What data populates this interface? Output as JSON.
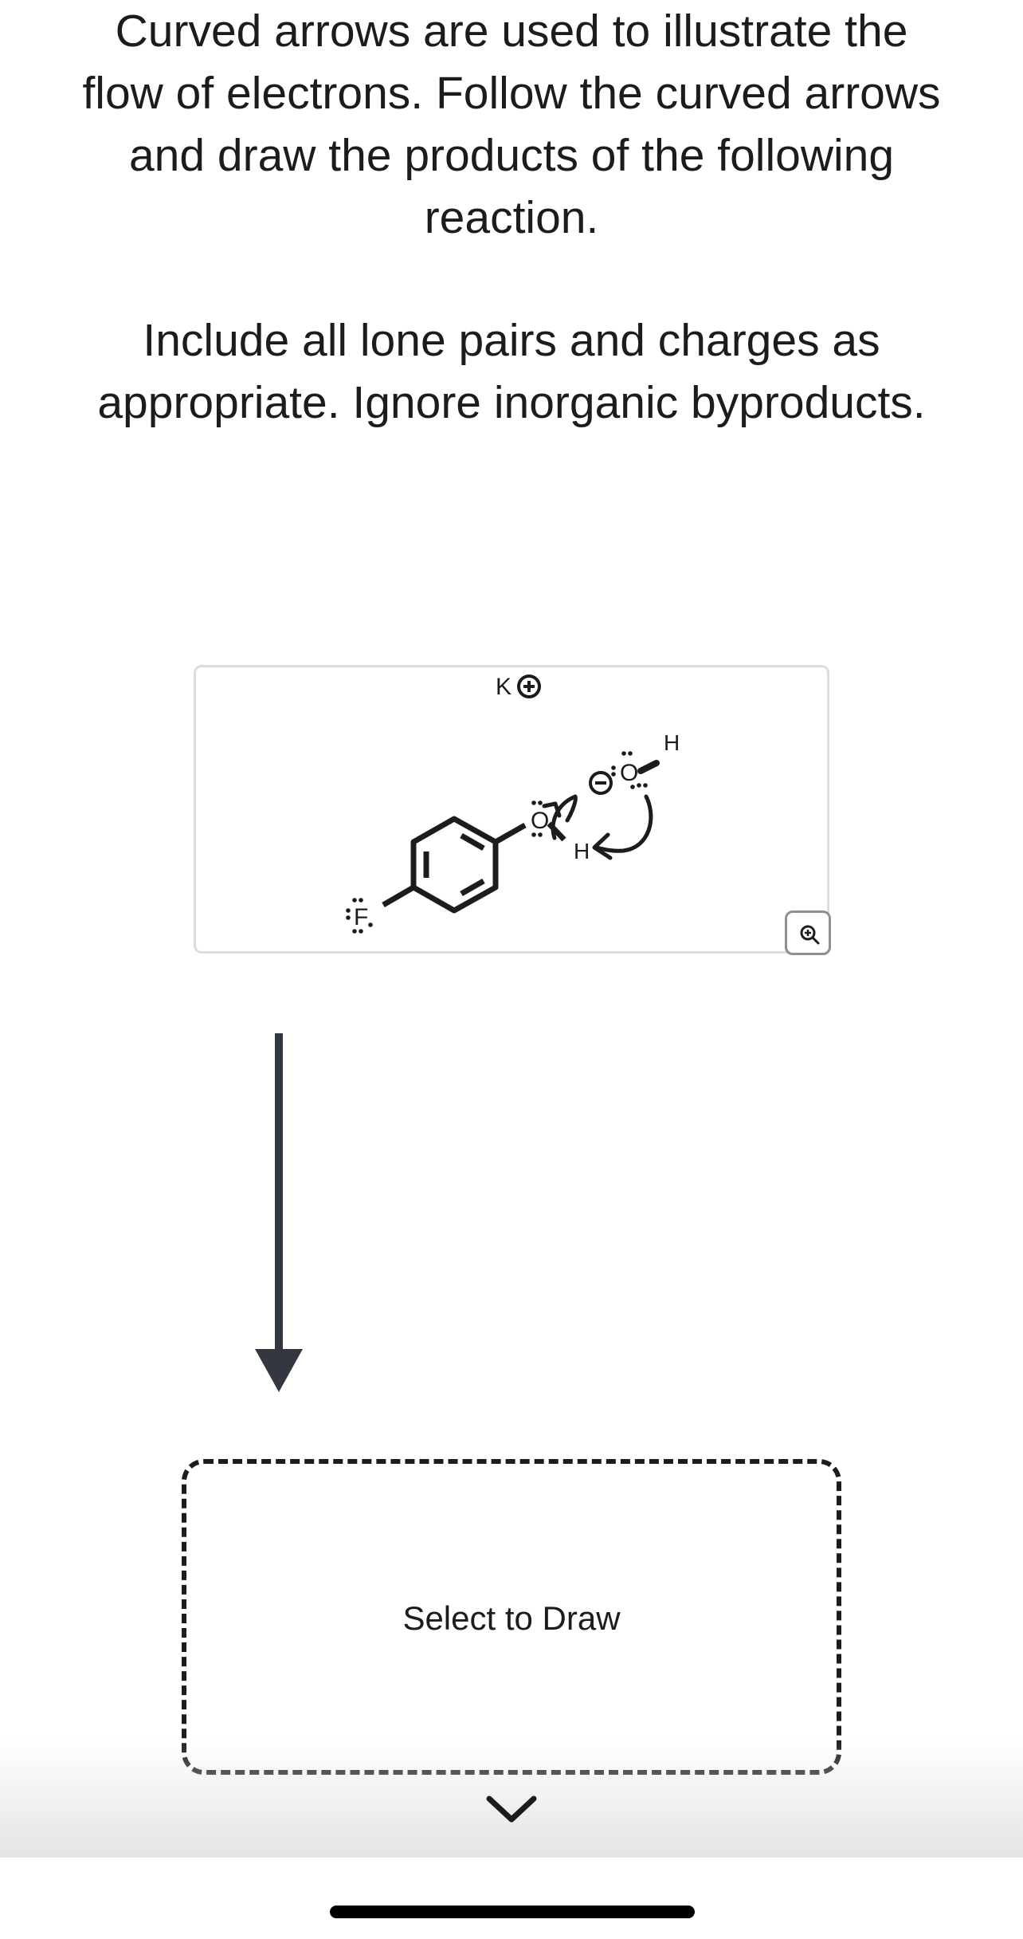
{
  "question_text": "Curved arrows are used to illustrate the flow of electrons. Follow the curved arrows and draw the products of the following reaction.",
  "instructions_text": "Include all lone pairs and charges as appropriate. Ignore inorganic byproducts.",
  "reactant": {
    "counter_ion": "K",
    "fluorine_label": "F",
    "phenol_oxygen_label": "O",
    "hydroxide_oxygen_label": "O",
    "hydroxide_hydrogen_label": "H",
    "phenol_hydrogen_label": "H"
  },
  "icons": {
    "zoom": "zoom-in-icon",
    "reaction_arrow": "down-arrow-icon",
    "chevron": "chevron-down-icon"
  },
  "answer_area": {
    "label": "Select to Draw"
  }
}
